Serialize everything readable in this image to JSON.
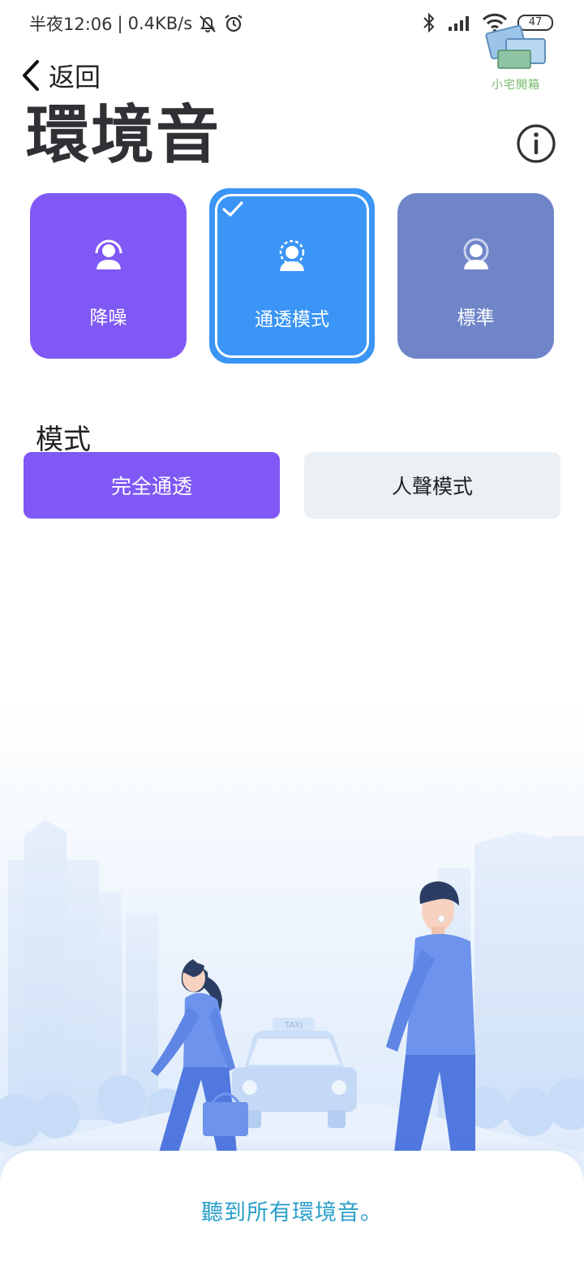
{
  "status_bar": {
    "time": "半夜12:06",
    "separator": "|",
    "speed": "0.4KB/s",
    "battery": "47"
  },
  "watermark": {
    "text": "小宅開箱"
  },
  "header": {
    "back_label": "返回",
    "title": "環境音"
  },
  "modes": {
    "items": [
      {
        "label": "降噪",
        "color": "#7f58f5"
      },
      {
        "label": "通透模式",
        "color": "#3a95f6",
        "selected": true
      },
      {
        "label": "標準",
        "color": "#6f85c8"
      }
    ]
  },
  "mode_section": {
    "label": "模式",
    "options": [
      {
        "label": "完全通透",
        "selected": true
      },
      {
        "label": "人聲模式",
        "selected": false
      }
    ]
  },
  "illustration": {
    "taxi_sign": "TAXI"
  },
  "description": "聽到所有環境音。"
}
